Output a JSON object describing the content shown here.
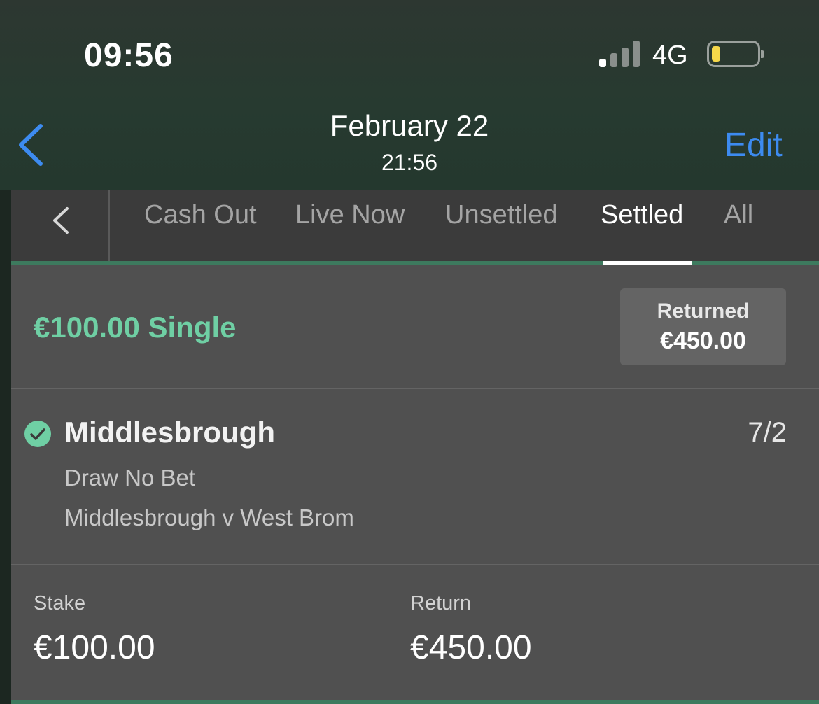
{
  "status_bar": {
    "time": "09:56",
    "network": "4G",
    "signal_bars_active": 1,
    "signal_bars_total": 4,
    "battery_level": 0.15,
    "battery_color": "#f6d84a"
  },
  "nav": {
    "back_icon": "chevron-left-icon",
    "date": "February 22",
    "time": "21:56",
    "edit_label": "Edit"
  },
  "tabs": {
    "back_icon": "chevron-left-icon",
    "items": [
      {
        "label": "Cash Out",
        "active": false
      },
      {
        "label": "Live Now",
        "active": false
      },
      {
        "label": "Unsettled",
        "active": false
      },
      {
        "label": "Settled",
        "active": true
      },
      {
        "label": "All",
        "active": false
      }
    ]
  },
  "bet": {
    "title": "€100.00 Single",
    "returned_label": "Returned",
    "returned_value": "€450.00",
    "status_icon": "check-circle-icon",
    "selection": "Middlesbrough",
    "odds": "7/2",
    "market": "Draw No Bet",
    "event": "Middlesbrough v West Brom",
    "stake_label": "Stake",
    "stake_value": "€100.00",
    "return_label": "Return",
    "return_value": "€450.00"
  },
  "colors": {
    "accent_green": "#6fcfa4",
    "link_blue": "#3d8bf0",
    "panel_bg": "#505050",
    "tabbar_bg": "#3b3b3b"
  }
}
